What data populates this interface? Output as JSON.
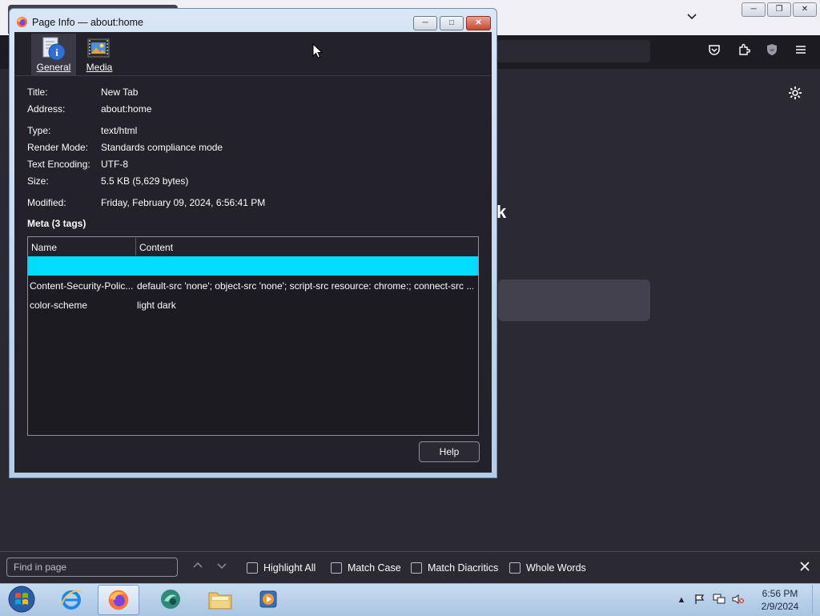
{
  "browser": {
    "titlebar_buttons": {
      "minimize": "─",
      "restore": "❐",
      "close": "✕"
    },
    "tab_list_icon": "chevron-down-icon",
    "toolbar_icons": [
      "pocket-icon",
      "extensions-icon",
      "ublock-icon",
      "menu-icon"
    ],
    "settings_icon": "gear-icon"
  },
  "dialog": {
    "title": "Page Info — about:home",
    "window_buttons": {
      "minimize": "─",
      "maximize": "□",
      "close": "✕"
    },
    "tabs": [
      {
        "label": "General",
        "icon": "info-icon",
        "selected": true
      },
      {
        "label": "Media",
        "icon": "media-icon",
        "selected": false
      }
    ],
    "general": {
      "title_label": "Title:",
      "title_value": "New Tab",
      "address_label": "Address:",
      "address_value": "about:home",
      "type_label": "Type:",
      "type_value": "text/html",
      "render_label": "Render Mode:",
      "render_value": "Standards compliance mode",
      "encoding_label": "Text Encoding:",
      "encoding_value": "UTF-8",
      "size_label": "Size:",
      "size_value": "5.5 KB (5,629 bytes)",
      "modified_label": "Modified:",
      "modified_value": "Friday, February 09, 2024, 6:56:41 PM"
    },
    "meta": {
      "heading": "Meta (3 tags)",
      "columns": [
        "Name",
        "Content"
      ],
      "rows": [
        {
          "name": "",
          "content": "",
          "selected": true
        },
        {
          "name": "Content-Security-Polic...",
          "content": "default-src 'none'; object-src 'none'; script-src resource: chrome:; connect-src ..."
        },
        {
          "name": "color-scheme",
          "content": "light dark"
        }
      ]
    },
    "help_label": "Help"
  },
  "findbar": {
    "placeholder": "Find in page",
    "options": [
      "Highlight All",
      "Match Case",
      "Match Diacritics",
      "Whole Words"
    ]
  },
  "taskbar": {
    "apps": [
      "start-orb",
      "internet-explorer",
      "firefox",
      "app-4",
      "file-explorer",
      "media-player"
    ],
    "time": "6:56 PM",
    "date": "2/9/2024"
  },
  "colors": {
    "accent_selection": "#00ddff",
    "dialog_bg": "#23222b",
    "browser_bg": "#2b2a33"
  }
}
